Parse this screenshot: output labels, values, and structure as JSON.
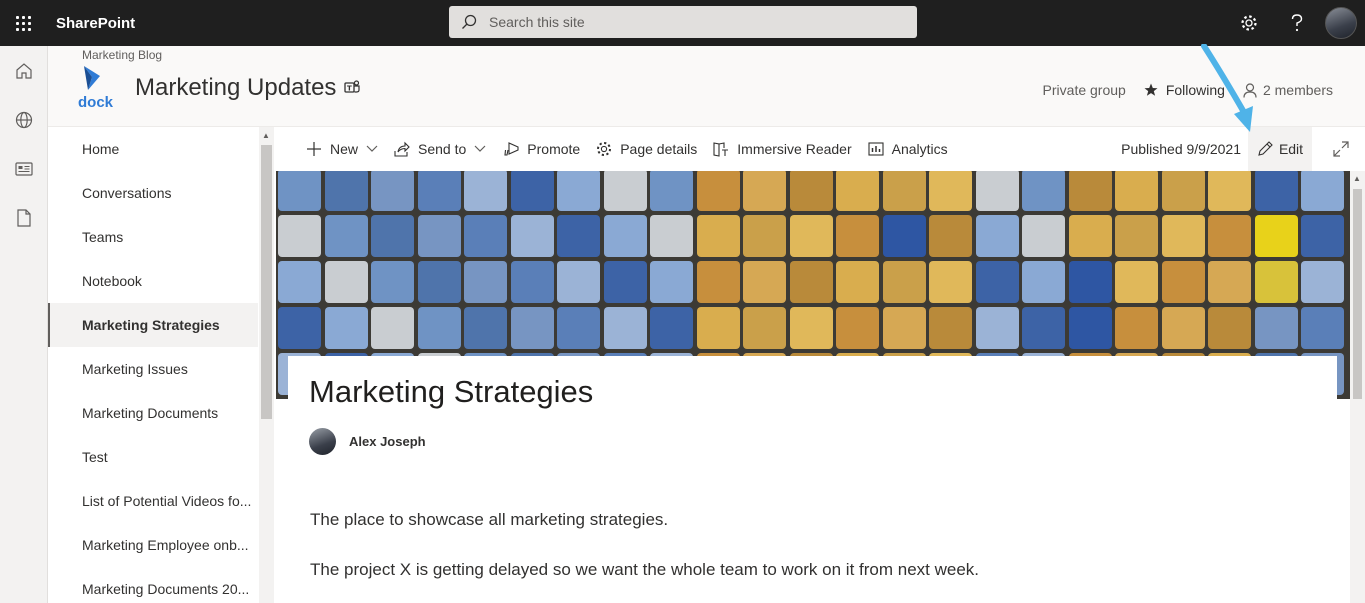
{
  "suite_bar": {
    "app_name": "SharePoint",
    "search_placeholder": "Search this site"
  },
  "site_header": {
    "breadcrumb": "Marketing Blog",
    "logo_text": "dock",
    "site_title": "Marketing Updates",
    "group_type": "Private group",
    "following_label": "Following",
    "members_label": "2 members"
  },
  "left_nav": {
    "items": [
      {
        "label": "Home"
      },
      {
        "label": "Conversations"
      },
      {
        "label": "Teams"
      },
      {
        "label": "Notebook"
      },
      {
        "label": "Marketing Strategies",
        "active": true
      },
      {
        "label": "Marketing Issues"
      },
      {
        "label": "Marketing Documents"
      },
      {
        "label": "Test"
      },
      {
        "label": "List of Potential Videos fo..."
      },
      {
        "label": "Marketing Employee onb..."
      },
      {
        "label": "Marketing Documents 20..."
      }
    ]
  },
  "command_bar": {
    "new_label": "New",
    "send_to_label": "Send to",
    "promote_label": "Promote",
    "page_details_label": "Page details",
    "immersive_reader_label": "Immersive Reader",
    "analytics_label": "Analytics",
    "published_label": "Published 9/9/2021",
    "edit_label": "Edit"
  },
  "page": {
    "title": "Marketing Strategies",
    "author": "Alex Joseph",
    "paragraphs": [
      "The place to showcase all marketing strategies.",
      "The project X is getting delayed so we want the whole team to work on it from next week."
    ]
  },
  "colors": {
    "suite_bar_bg": "#1f1f1f",
    "annotation_arrow": "#4fb3e8"
  },
  "icons": [
    "waffle-icon",
    "search-icon",
    "gear-icon",
    "help-icon",
    "home-icon",
    "globe-icon",
    "news-icon",
    "document-icon",
    "teams-icon",
    "star-icon",
    "person-icon",
    "plus-icon",
    "send-icon",
    "megaphone-icon",
    "gear-icon",
    "immersive-reader-icon",
    "analytics-icon",
    "pencil-icon",
    "expand-icon"
  ]
}
